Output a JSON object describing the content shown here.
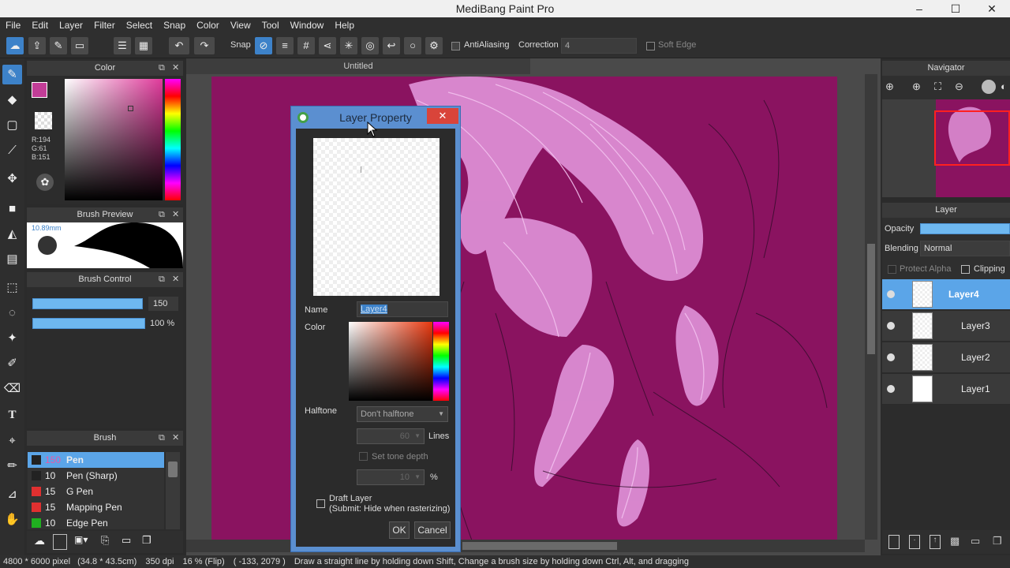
{
  "window": {
    "title": "MediBang Paint Pro",
    "minimize": "–",
    "maximize": "☐",
    "close": "✕"
  },
  "menu": [
    "File",
    "Edit",
    "Layer",
    "Filter",
    "Select",
    "Snap",
    "Color",
    "View",
    "Tool",
    "Window",
    "Help"
  ],
  "toolbar": {
    "snap_label": "Snap",
    "antialiasing_label": "AntiAliasing",
    "correction_label": "Correction",
    "correction_value": "4",
    "soft_edge_label": "Soft Edge"
  },
  "color_panel": {
    "title": "Color",
    "rgb_r": "R:194",
    "rgb_g": "G:61",
    "rgb_b": "B:151",
    "main_color": "#c23d97"
  },
  "brush_preview": {
    "title": "Brush Preview",
    "size_text": "10.89mm"
  },
  "brush_control": {
    "title": "Brush Control",
    "size_value": "150",
    "opacity_value": "100 %"
  },
  "brush_panel": {
    "title": "Brush",
    "items": [
      {
        "size": "150",
        "name": "Pen",
        "color": "#222222",
        "selected": true
      },
      {
        "size": "10",
        "name": "Pen (Sharp)",
        "color": "#222222",
        "selected": false
      },
      {
        "size": "15",
        "name": "G Pen",
        "color": "#e03030",
        "selected": false
      },
      {
        "size": "15",
        "name": "Mapping Pen",
        "color": "#e03030",
        "selected": false
      },
      {
        "size": "10",
        "name": "Edge Pen",
        "color": "#20b020",
        "selected": false
      }
    ]
  },
  "document": {
    "tab_title": "Untitled",
    "canvas_color": "#8a1360"
  },
  "dialog": {
    "title": "Layer Property",
    "name_label": "Name",
    "name_value": "Layer4",
    "color_label": "Color",
    "halftone_label": "Halftone",
    "halftone_value": "Don't halftone",
    "lines_value": "60",
    "lines_label": "Lines",
    "tone_depth_label": "Set tone depth",
    "percent_value": "10",
    "percent_label": "%",
    "draft_label": "Draft Layer",
    "draft_sub": "(Submit: Hide when rasterizing)",
    "ok_label": "OK",
    "cancel_label": "Cancel"
  },
  "navigator": {
    "title": "Navigator"
  },
  "layer_panel": {
    "title": "Layer",
    "opacity_label": "Opacity",
    "blending_label": "Blending",
    "blending_value": "Normal",
    "protect_alpha_label": "Protect Alpha",
    "clipping_label": "Clipping",
    "layers": [
      {
        "name": "Layer4",
        "selected": true
      },
      {
        "name": "Layer3",
        "selected": false
      },
      {
        "name": "Layer2",
        "selected": false
      },
      {
        "name": "Layer1",
        "selected": false
      }
    ]
  },
  "status": {
    "size": "4800 * 6000 pixel",
    "physical": "(34.8 * 43.5cm)",
    "dpi": "350 dpi",
    "zoom": "16 % (Flip)",
    "coords": "( -133, 2079 )",
    "hint": "Draw a straight line by holding down Shift, Change a brush size by holding down Ctrl, Alt, and dragging"
  }
}
